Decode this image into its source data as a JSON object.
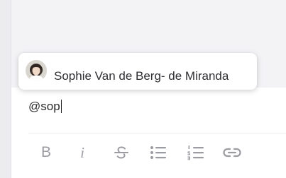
{
  "composer": {
    "input_value": "@sop"
  },
  "mention_popup": {
    "suggestion_name": "Sophie Van de Berg- de Miranda",
    "avatar_icon": "user-avatar-photo"
  },
  "toolbar": {
    "bold_label": "B",
    "italic_label": "i",
    "icons": [
      "bold-icon",
      "italic-icon",
      "strikethrough-icon",
      "bulleted-list-icon",
      "numbered-list-icon",
      "link-icon"
    ]
  },
  "colors": {
    "toolbar_icon": "#9b9ba2",
    "background": "#f2f2f5",
    "popup_bg": "#ffffff"
  }
}
